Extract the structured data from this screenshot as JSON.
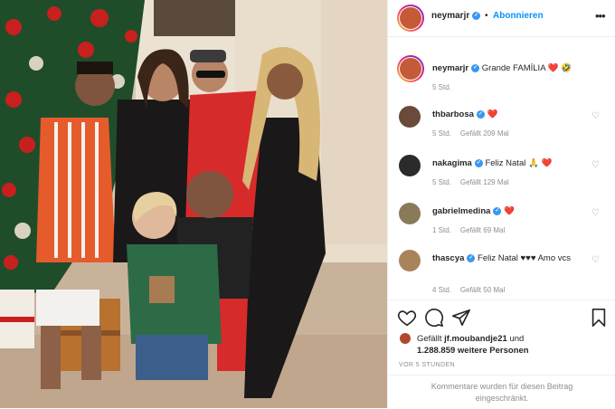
{
  "post": {
    "author": "neymarjr",
    "follow_label": "Abonnieren",
    "more_label": "•••",
    "separator": "•",
    "caption": {
      "username": "neymarjr",
      "text": "Grande FAMÍLIA ❤️ 🤣",
      "time": "5 Std."
    }
  },
  "comments": [
    {
      "username": "thbarbosa",
      "text": "❤️",
      "time": "5 Std.",
      "likes": "Gefällt 209 Mal"
    },
    {
      "username": "nakagima",
      "text": "Feliz Natal 🙏 ❤️",
      "time": "5 Std.",
      "likes": "Gefällt 129 Mal"
    },
    {
      "username": "gabrielmedina",
      "text": "❤️",
      "time": "1 Std.",
      "likes": "Gefällt 69 Mal"
    },
    {
      "username": "thascya",
      "text": "Feliz Natal ♥♥♥ Amo vcs",
      "time": "4 Std.",
      "likes": "Gefällt 50 Mal"
    }
  ],
  "actions": {
    "liked_by_prefix": "Gefällt",
    "liked_by_user": "jf.moubandje21",
    "liked_by_suffix": "und",
    "liked_count": "1.288.859",
    "liked_count_suffix": "weitere Personen",
    "timestamp": "VOR 5 STUNDEN"
  },
  "restricted_notice": "Kommentare wurden für diesen Beitrag eingeschränkt.",
  "colors": {
    "verified": "#3897f0",
    "follow": "#0095f6",
    "heart": "#ed2a3a",
    "muted": "#8e8e8e"
  },
  "icons": [
    "heart-icon",
    "comment-icon",
    "share-icon",
    "bookmark-icon",
    "more-options-icon",
    "verified-badge-icon"
  ]
}
